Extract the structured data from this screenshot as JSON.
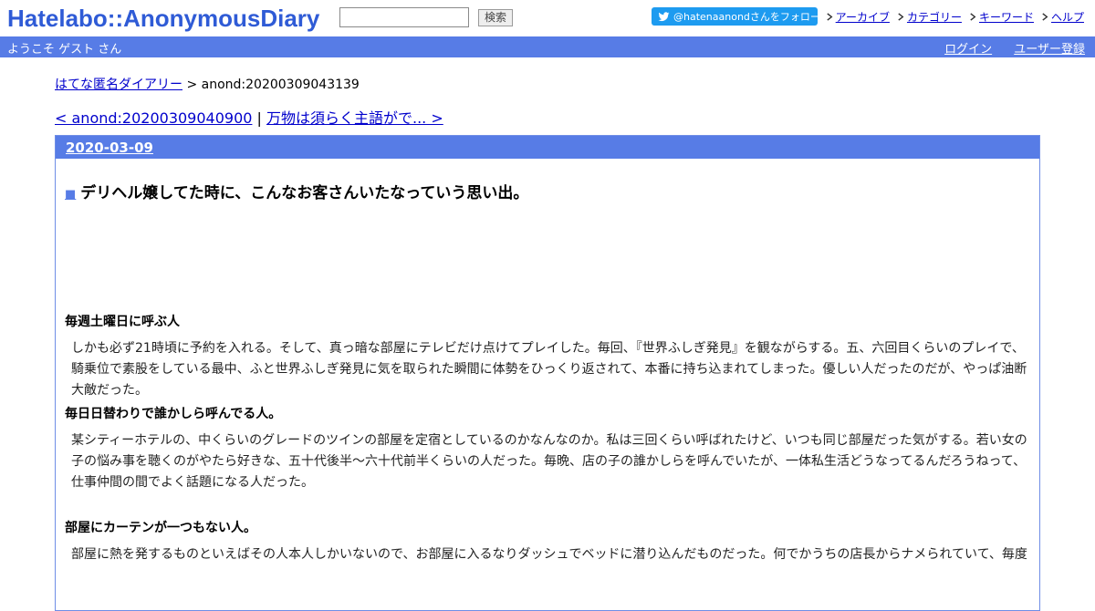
{
  "header": {
    "logo_text": "Hatelabo::AnonymousDiary",
    "search_value": "",
    "search_button_label": "検索",
    "twitter_label": "@hatenaanondさんをフォロー",
    "top_links": [
      "アーカイブ",
      "カテゴリー",
      "キーワード",
      "ヘルプ"
    ]
  },
  "bar": {
    "welcome": "ようこそ ゲスト さん",
    "login": "ログイン",
    "register": "ユーザー登録"
  },
  "breadcrumb": {
    "home": "はてな匿名ダイアリー",
    "separator": " > ",
    "current": "anond:20200309043139"
  },
  "pager": {
    "prev": "< anond:20200309040900",
    "separator": " | ",
    "next": "万物は須らく主語がで... >"
  },
  "day": {
    "date": "2020-03-09",
    "title_mark": "■",
    "title": "デリヘル嬢してた時に、こんなお客さんいたなっていう思い出。",
    "sections": [
      {
        "heading": "毎週土曜日に呼ぶ人",
        "body": "しかも必ず21時頃に予約を入れる。そして、真っ暗な部屋にテレビだけ点けてプレイした。毎回、『世界ふしぎ発見』を観ながらする。五、六回目くらいのプレイで、騎乗位で素股をしている最中、ふと世界ふしぎ発見に気を取られた瞬間に体勢をひっくり返されて、本番に持ち込まれてしまった。優しい人だったのだが、やっぱ油断大敵だった。"
      },
      {
        "heading": "毎日日替わりで誰かしら呼んでる人。",
        "body": "某シティーホテルの、中くらいのグレードのツインの部屋を定宿としているのかなんなのか。私は三回くらい呼ばれたけど、いつも同じ部屋だった気がする。若い女の子の悩み事を聴くのがやたら好きな、五十代後半～六十代前半くらいの人だった。毎晩、店の子の誰かしらを呼んでいたが、一体私生活どうなってるんだろうねって、仕事仲間の間でよく話題になる人だった。"
      },
      {
        "heading": "部屋にカーテンが一つもない人。",
        "body": "部屋に熱を発するものといえばその人本人しかいないので、お部屋に入るなりダッシュでベッドに潜り込んだものだった。何でかうちの店長からナメられていて、毎度"
      }
    ]
  }
}
